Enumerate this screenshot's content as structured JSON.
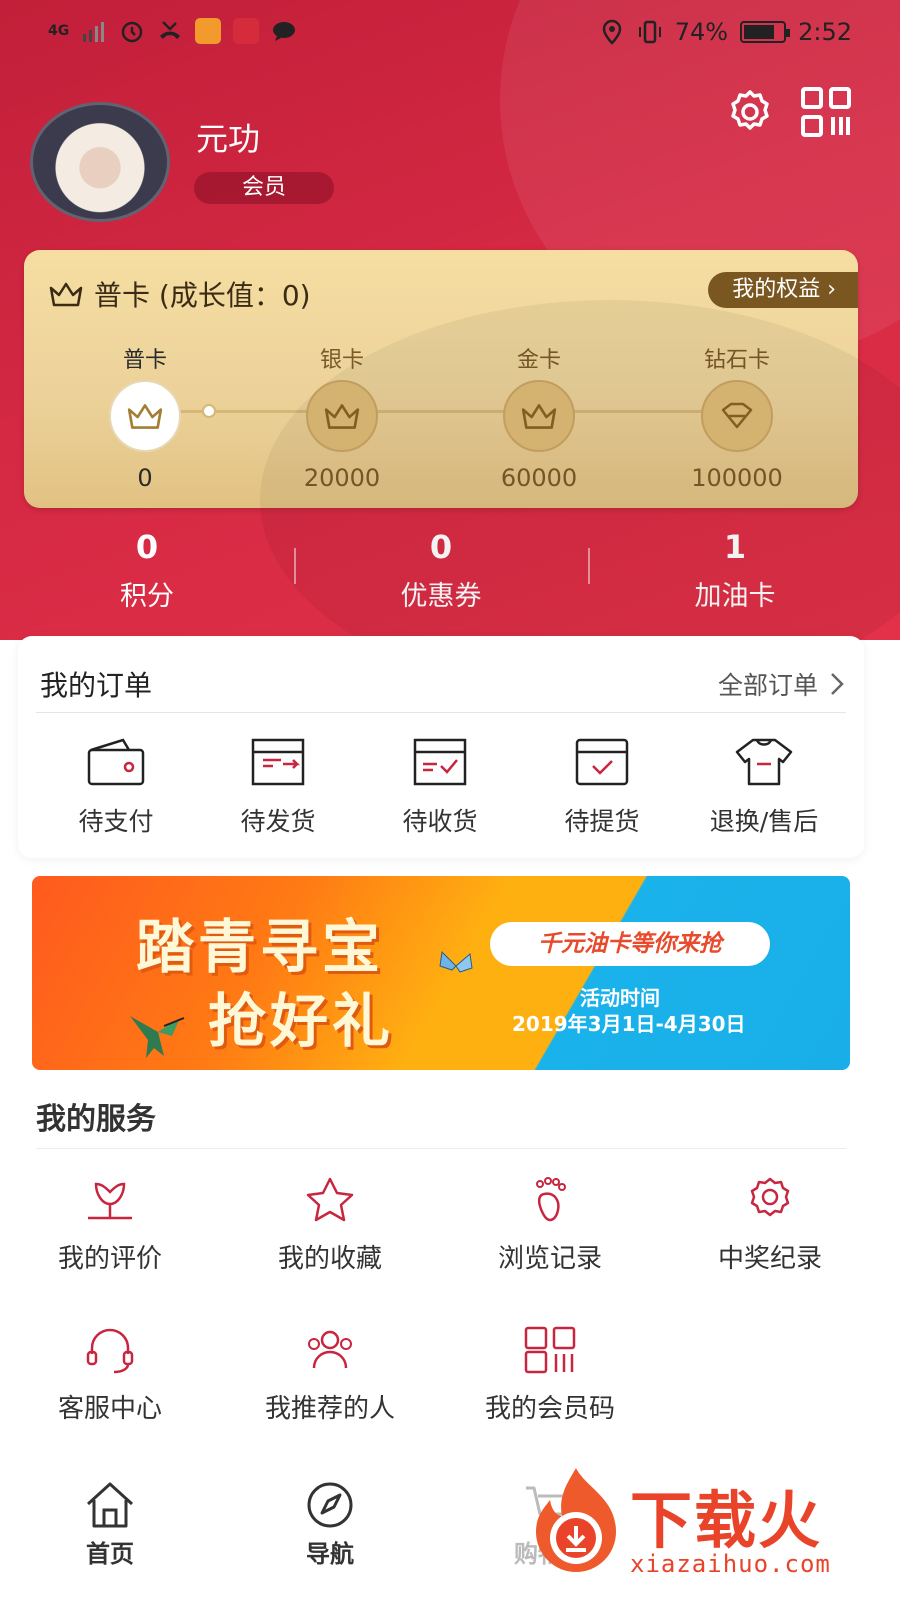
{
  "status_bar": {
    "network": "4G",
    "battery": "74%",
    "time": "2:52"
  },
  "profile": {
    "name": "元功",
    "member_tag": "会员"
  },
  "level_card": {
    "title": "普卡 (成长值：0)",
    "rights_button": "我的权益",
    "levels": [
      {
        "name": "普卡",
        "value": "0",
        "icon": "crown-icon"
      },
      {
        "name": "银卡",
        "value": "20000",
        "icon": "crown-icon"
      },
      {
        "name": "金卡",
        "value": "60000",
        "icon": "crown-icon"
      },
      {
        "name": "钻石卡",
        "value": "100000",
        "icon": "diamond-icon"
      }
    ]
  },
  "stats": [
    {
      "value": "0",
      "label": "积分"
    },
    {
      "value": "0",
      "label": "优惠券"
    },
    {
      "value": "1",
      "label": "加油卡"
    }
  ],
  "orders": {
    "title": "我的订单",
    "all_link": "全部订单",
    "items": [
      {
        "label": "待支付",
        "icon": "wallet-icon"
      },
      {
        "label": "待发货",
        "icon": "ship-box-icon"
      },
      {
        "label": "待收货",
        "icon": "receive-box-icon"
      },
      {
        "label": "待提货",
        "icon": "pickup-calendar-icon"
      },
      {
        "label": "退换/售后",
        "icon": "return-shirt-icon"
      }
    ]
  },
  "banner": {
    "title_line1": "踏青寻宝",
    "title_line2": "抢好礼",
    "pill": "千元油卡等你来抢",
    "sub1": "活动时间",
    "sub2": "2019年3月1日-4月30日"
  },
  "services": {
    "title": "我的服务",
    "items": [
      {
        "label": "我的评价",
        "icon": "flower-icon"
      },
      {
        "label": "我的收藏",
        "icon": "star-icon"
      },
      {
        "label": "浏览记录",
        "icon": "footprint-icon"
      },
      {
        "label": "中奖纪录",
        "icon": "award-icon"
      },
      {
        "label": "客服中心",
        "icon": "headset-icon"
      },
      {
        "label": "我推荐的人",
        "icon": "people-icon"
      },
      {
        "label": "我的会员码",
        "icon": "qr-code-icon"
      }
    ]
  },
  "bottom_nav": {
    "items": [
      {
        "label": "首页",
        "icon": "home-icon"
      },
      {
        "label": "导航",
        "icon": "compass-icon"
      },
      {
        "label": "购物车",
        "icon": "cart-icon"
      }
    ]
  },
  "watermark": {
    "text": "下载火",
    "url": "xiazaihuo.com"
  },
  "colors": {
    "brand_red": "#d42843",
    "gold": "#ecd29a",
    "gold_dark": "#7a5720",
    "accent_icon": "#c8253f"
  }
}
